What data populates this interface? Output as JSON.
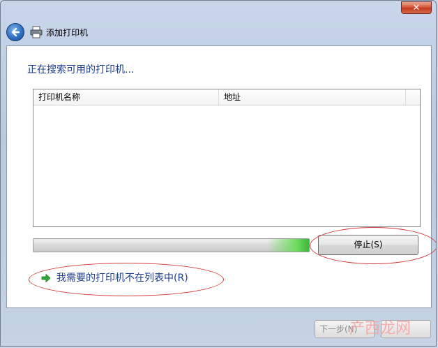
{
  "window": {
    "close_symbol": "✕"
  },
  "nav": {
    "back_icon": "back-arrow-icon",
    "printer_icon": "printer-icon",
    "title": "添加打印机"
  },
  "main": {
    "heading": "正在搜索可用的打印机...",
    "list": {
      "columns": [
        "打印机名称",
        "地址"
      ],
      "rows": []
    },
    "progress": {
      "state": "searching"
    },
    "stop_button": "停止(S)",
    "not_listed_link": "我需要的打印机不在列表中(R)"
  },
  "footer": {
    "next_button": "下一步(N)"
  },
  "watermark_text": "产西龙网",
  "colors": {
    "heading": "#1e3c8c",
    "annotation_ellipse": "#d23a3a",
    "progress_glow": "#6fdc5f"
  }
}
